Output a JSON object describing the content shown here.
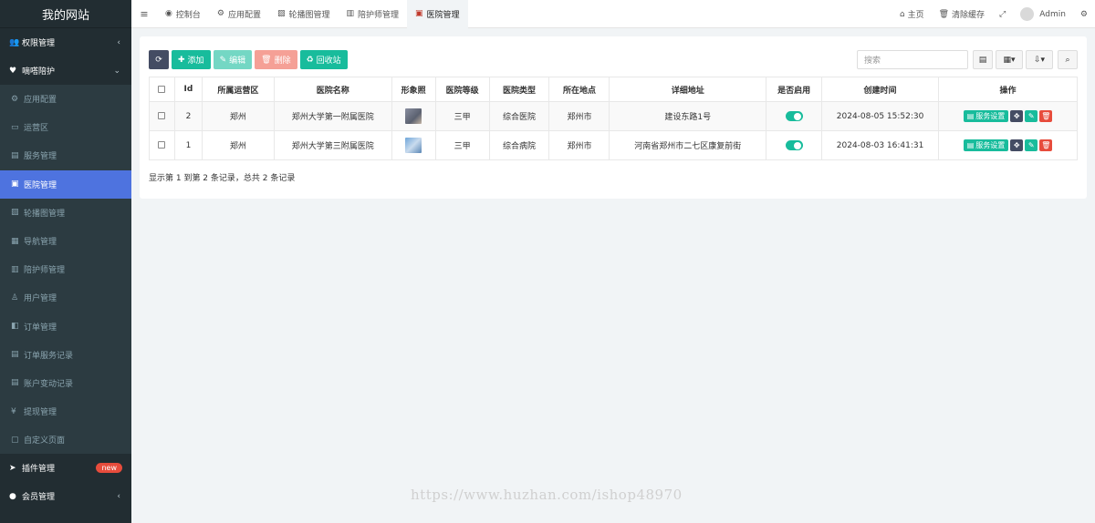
{
  "sidebar": {
    "brand": "我的网站",
    "group_auth": "权限管理",
    "group_care": "嘀嗒陪护",
    "items": [
      {
        "label": "应用配置",
        "icon": "⚙"
      },
      {
        "label": "运营区",
        "icon": "▭"
      },
      {
        "label": "服务管理",
        "icon": "▤"
      },
      {
        "label": "医院管理",
        "icon": "▣"
      },
      {
        "label": "轮播图管理",
        "icon": "▨"
      },
      {
        "label": "导航管理",
        "icon": "▦"
      },
      {
        "label": "陪护师管理",
        "icon": "▥"
      },
      {
        "label": "用户管理",
        "icon": "♙"
      },
      {
        "label": "订单管理",
        "icon": "◧"
      },
      {
        "label": "订单服务记录",
        "icon": "▤"
      },
      {
        "label": "账户变动记录",
        "icon": "▤"
      },
      {
        "label": "提现管理",
        "icon": "¥"
      },
      {
        "label": "自定义页面",
        "icon": "▢"
      }
    ],
    "group_plugin": "插件管理",
    "plugin_badge": "new",
    "group_member": "会员管理"
  },
  "topbar": {
    "tabs": [
      {
        "label": "控制台",
        "icon": "◉"
      },
      {
        "label": "应用配置",
        "icon": "⚙"
      },
      {
        "label": "轮播图管理",
        "icon": "▨"
      },
      {
        "label": "陪护师管理",
        "icon": "▥"
      },
      {
        "label": "医院管理",
        "icon": "▣"
      }
    ],
    "home": "主页",
    "clear_cache": "清除缓存",
    "user": "Admin"
  },
  "toolbar": {
    "add": "添加",
    "edit": "编辑",
    "delete": "删除",
    "recycle": "回收站",
    "search_placeholder": "搜索"
  },
  "table": {
    "headers": [
      "Id",
      "所属运营区",
      "医院名称",
      "形象照",
      "医院等级",
      "医院类型",
      "所在地点",
      "详细地址",
      "是否启用",
      "创建时间",
      "操作"
    ],
    "service_label": "服务设置",
    "rows": [
      {
        "id": "2",
        "region": "郑州",
        "name": "郑州大学第一附属医院",
        "level": "三甲",
        "type": "综合医院",
        "city": "郑州市",
        "address": "建设东路1号",
        "created": "2024-08-05 15:52:30"
      },
      {
        "id": "1",
        "region": "郑州",
        "name": "郑州大学第三附属医院",
        "level": "三甲",
        "type": "综合病院",
        "city": "郑州市",
        "address": "河南省郑州市二七区康复前街",
        "created": "2024-08-03 16:41:31"
      }
    ]
  },
  "summary": "显示第 1 到第 2 条记录，总共 2 条记录",
  "watermark": "https://www.huzhan.com/ishop48970",
  "colors": {
    "primary": "#4e73df",
    "success": "#18bc9c",
    "danger": "#e74c3c",
    "sidebar": "#222d32"
  }
}
